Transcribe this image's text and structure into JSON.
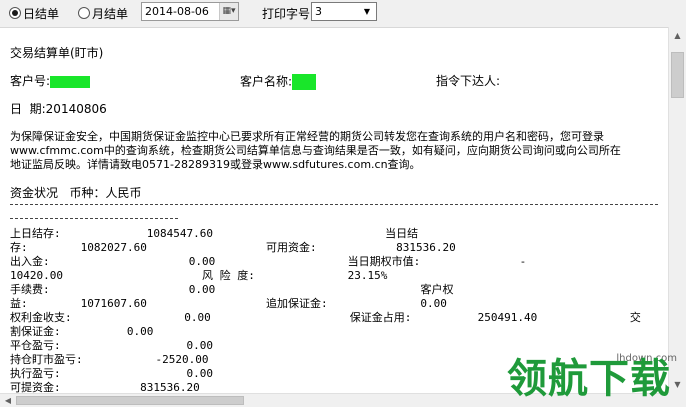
{
  "toolbar": {
    "radio_daily": "日结单",
    "radio_monthly": "月结单",
    "date_value": "2014-08-06",
    "print_label": "打印字号",
    "font_size_value": "3"
  },
  "document": {
    "title": "交易结算单(盯市)",
    "customer_no_label": "客户号:",
    "customer_name_label": "客户名称:",
    "instruction_label": "指令下达人:",
    "date_line": "日  期:20140806",
    "notice_1": "为保障保证金安全，中国期货保证金监控中心已要求所有正常经营的期货公司转发您在查询系统的用户名和密码，您可登录",
    "notice_2": "www.cfmmc.com中的查询系统，检查期货公司结算单信息与查询结果是否一致，如有疑问，应向期货公司询问或向公司所在",
    "notice_3": "地证监局反映。详情请致电0571-28289319或登录www.sdfutures.com.cn查询。",
    "fund_header": "资金状况   币种：人民币",
    "rows": [
      "上日结存:             1084547.60                          当日结",
      "存:        1082027.60                  可用资金:            831536.20",
      "出入金:                     0.00                    当日期权市值:               -",
      "10420.00                     风 险 度:              23.15%",
      "手续费:                     0.00                               客户权",
      "益:        1071607.60                  追加保证金:              0.00",
      "权利金收支:                 0.00                     保证金占用:          250491.40              交",
      "割保证金:          0.00",
      "平仓盈亏:                   0.00",
      "持仓盯市盈亏:           -2520.00",
      "执行盈亏:                   0.00",
      "可提资金:            831536.20"
    ]
  },
  "watermark": {
    "brand": "领航下载",
    "url": "lhdown.com"
  }
}
